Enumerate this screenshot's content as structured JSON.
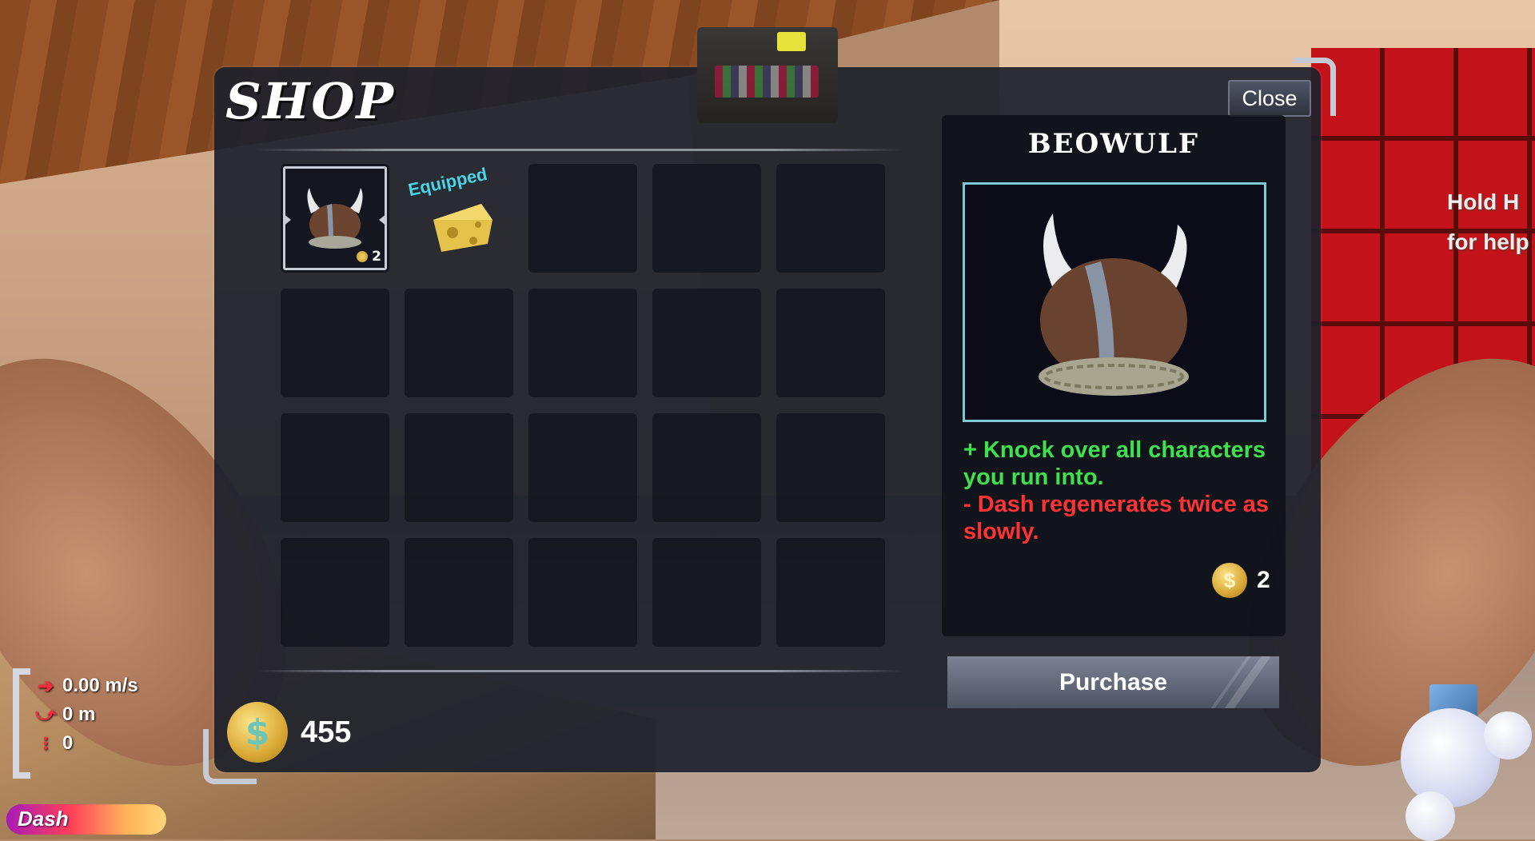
{
  "shop": {
    "title": "SHOP",
    "close_label": "Close",
    "help_line1": "Hold H",
    "help_line2": "for help",
    "items": [
      {
        "name": "viking-helmet",
        "price": "2",
        "selected": true
      },
      {
        "name": "cheese",
        "equipped_label": "Equipped"
      }
    ],
    "empty_slot_count": 18,
    "detail": {
      "name": "BEOWULF",
      "effect_positive": "+ Knock over all characters you run into.",
      "effect_negative": "-  Dash regenerates twice as slowly.",
      "price": "2"
    },
    "purchase_label": "Purchase",
    "balance": "455",
    "colors": {
      "panel": "#1e212c",
      "positive": "#3fe14f",
      "negative": "#ff3333",
      "equipped": "#4fd3e4",
      "preview_border": "#7fc9d4"
    }
  },
  "hud": {
    "speed": "0.00 m/s",
    "distance": "0 m",
    "count": "0",
    "speed_icon": "arrow-right-icon",
    "distance_icon": "jump-arc-icon",
    "count_icon": "dots-icon",
    "dash_label": "Dash",
    "dash_fill_fraction": 1.0
  }
}
